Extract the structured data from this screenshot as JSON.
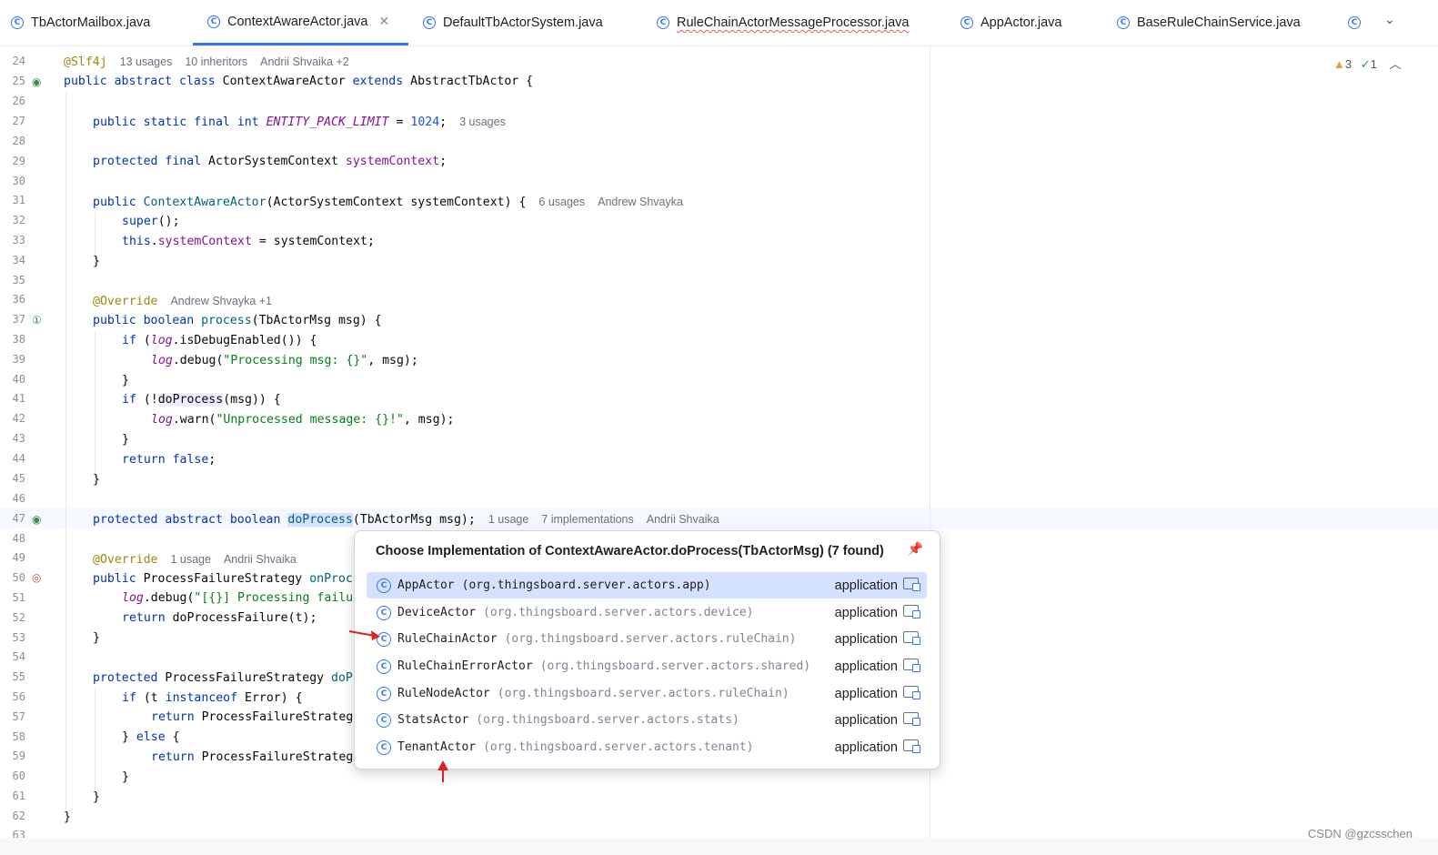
{
  "tabs": [
    {
      "label": "TbActorMailbox.java",
      "active": false,
      "error": false
    },
    {
      "label": "ContextAwareActor.java",
      "active": true,
      "error": false
    },
    {
      "label": "DefaultTbActorSystem.java",
      "active": false,
      "error": false
    },
    {
      "label": "RuleChainActorMessageProcessor.java",
      "active": false,
      "error": true
    },
    {
      "label": "AppActor.java",
      "active": false,
      "error": false
    },
    {
      "label": "BaseRuleChainService.java",
      "active": false,
      "error": false
    }
  ],
  "class_icon_glyph": "C",
  "inspections": {
    "warnings": "3",
    "ok": "1"
  },
  "line_numbers": [
    "24",
    "25",
    "26",
    "27",
    "28",
    "29",
    "30",
    "31",
    "32",
    "33",
    "34",
    "35",
    "36",
    "37",
    "38",
    "39",
    "40",
    "41",
    "42",
    "43",
    "44",
    "45",
    "46",
    "47",
    "48",
    "49",
    "50",
    "51",
    "52",
    "53",
    "54",
    "55",
    "56",
    "57",
    "58",
    "59",
    "60",
    "61",
    "62",
    "63"
  ],
  "code": {
    "l24": {
      "ann": "@Slf4j",
      "hints": [
        "13 usages",
        "10 inheritors",
        "Andrii Shvaika +2"
      ]
    },
    "l25": {
      "a": "public abstract class ",
      "b": "ContextAwareActor ",
      "c": "extends ",
      "d": "AbstractTbActor ",
      "e": "{"
    },
    "l27": {
      "a": "public static final int ",
      "b": "ENTITY_PACK_LIMIT",
      "c": " = ",
      "d": "1024",
      "e": ";",
      "hint": "3 usages"
    },
    "l29": {
      "a": "protected final ",
      "b": "ActorSystemContext ",
      "c": "systemContext",
      ";": ";"
    },
    "l31": {
      "a": "public ",
      "b": "ContextAwareActor",
      "c": "(ActorSystemContext systemContext) {",
      "hints": [
        "6 usages",
        "Andrew Shvayka"
      ]
    },
    "l32": {
      "a": "super",
      "b": "();"
    },
    "l33": {
      "a": "this",
      "b": ".",
      "c": "systemContext",
      "d": " = systemContext;"
    },
    "l34": "}",
    "l36": {
      "ann": "@Override",
      "hint": "Andrew Shvayka +1"
    },
    "l37": {
      "a": "public boolean ",
      "b": "process",
      "c": "(TbActorMsg msg) {"
    },
    "l38": {
      "a": "if ",
      "b": "(",
      "c": "log",
      ".isDebugEnabled()) {": ".isDebugEnabled()) {"
    },
    "l39": {
      "a": "log",
      ".debug(": ".debug(",
      "s": "\"Processing msg: {}\"",
      "r": ", msg);"
    },
    "l40": "}",
    "l41": {
      "a": "if ",
      "b": "(!",
      "c": "doProcess",
      "d": "(msg)) {"
    },
    "l42": {
      "a": "log",
      "b": ".warn(",
      "s": "\"Unprocessed message: {}!\"",
      "r": ", msg);"
    },
    "l43": "}",
    "l44": {
      "a": "return ",
      "b": "false",
      ";": ";"
    },
    "l45": "}",
    "l47": {
      "a": "protected abstract boolean ",
      "sel": "doProcess",
      "c": "(TbActorMsg msg);",
      "hints": [
        "1 usage",
        "7 implementations",
        "Andrii Shvaika"
      ]
    },
    "l49": {
      "ann": "@Override",
      "hints": [
        "1 usage",
        "Andrii Shvaika"
      ]
    },
    "l50": {
      "a": "public ",
      "b": "ProcessFailureStrategy ",
      "c": "onProc"
    },
    "l51": {
      "a": "log",
      "b": ".debug(",
      "s": "\"[{}] Processing failu"
    },
    "l52": {
      "a": "return ",
      "b": "doProcessFailure",
      "c": "(t);"
    },
    "l53": "}",
    "l55": {
      "a": "protected ",
      "b": "ProcessFailureStrategy ",
      "c": "doP"
    },
    "l56": {
      "a": "if ",
      "b": "(t ",
      "c": "instanceof ",
      "d": "Error) {"
    },
    "l57": {
      "a": "return ",
      "b": "ProcessFailureStrateg"
    },
    "l58": {
      "a": "} ",
      "b": "else ",
      "c": "{"
    },
    "l59": {
      "a": "return ",
      "b": "ProcessFailureStrateg"
    },
    "l60": "}",
    "l61": "}",
    "l62": "}"
  },
  "popup": {
    "title": "Choose Implementation of ContextAwareActor.doProcess(TbActorMsg) (7 found)",
    "items": [
      {
        "name": "AppActor",
        "pkg": "(org.thingsboard.server.actors.app)",
        "module": "application",
        "selected": true
      },
      {
        "name": "DeviceActor",
        "pkg": "(org.thingsboard.server.actors.device)",
        "module": "application",
        "selected": false
      },
      {
        "name": "RuleChainActor",
        "pkg": "(org.thingsboard.server.actors.ruleChain)",
        "module": "application",
        "selected": false
      },
      {
        "name": "RuleChainErrorActor",
        "pkg": "(org.thingsboard.server.actors.shared)",
        "module": "application",
        "selected": false
      },
      {
        "name": "RuleNodeActor",
        "pkg": "(org.thingsboard.server.actors.ruleChain)",
        "module": "application",
        "selected": false
      },
      {
        "name": "StatsActor",
        "pkg": "(org.thingsboard.server.actors.stats)",
        "module": "application",
        "selected": false
      },
      {
        "name": "TenantActor",
        "pkg": "(org.thingsboard.server.actors.tenant)",
        "module": "application",
        "selected": false
      }
    ]
  },
  "watermark": "CSDN @gzcsschen",
  "colors": {
    "accent": "#3574f0",
    "keyword": "#0033b3",
    "annotation": "#9e880d",
    "field": "#871094",
    "string": "#067d17",
    "arrow": "#e02020"
  }
}
